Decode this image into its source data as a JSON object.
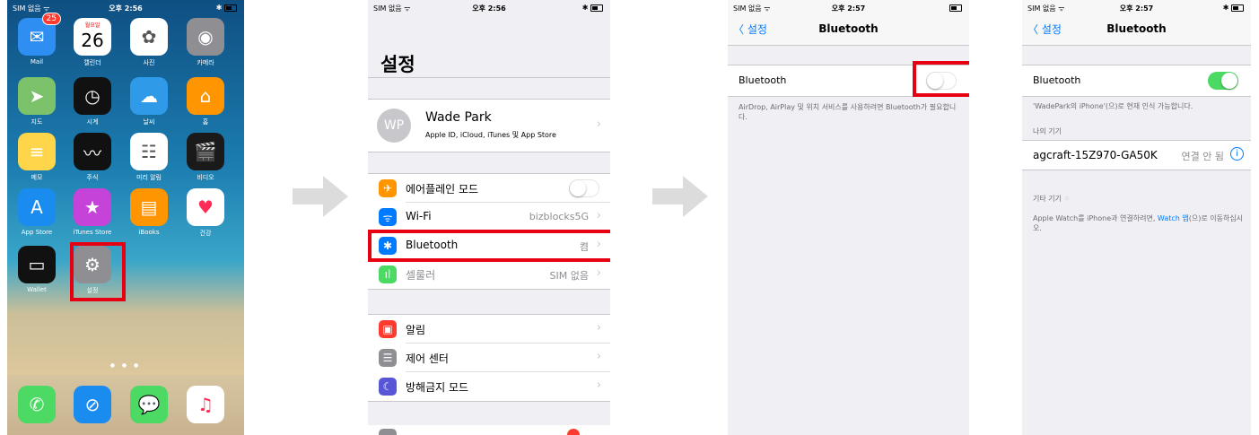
{
  "home": {
    "status": {
      "carrier": "SIM 없음 ᯤ",
      "time": "오후 2:56",
      "battery": "✱"
    },
    "apps": [
      {
        "label": "Mail",
        "icon": "mail-icon",
        "glyph": "✉",
        "color": "#2f8ef2",
        "badge": "25"
      },
      {
        "label": "캘린더",
        "icon": "calendar-icon",
        "glyph": "26",
        "color": "#ffffff",
        "sub": "월요일"
      },
      {
        "label": "사진",
        "icon": "photos-icon",
        "glyph": "✿",
        "color": "#ffffff"
      },
      {
        "label": "카메라",
        "icon": "camera-icon",
        "glyph": "◉",
        "color": "#8e8e93"
      },
      {
        "label": "지도",
        "icon": "maps-icon",
        "glyph": "➤",
        "color": "#7cc26b"
      },
      {
        "label": "시계",
        "icon": "clock-icon",
        "glyph": "◷",
        "color": "#111111"
      },
      {
        "label": "날씨",
        "icon": "weather-icon",
        "glyph": "☁",
        "color": "#2f9be8"
      },
      {
        "label": "홈",
        "icon": "home-icon",
        "glyph": "⌂",
        "color": "#ff9500"
      },
      {
        "label": "메모",
        "icon": "notes-icon",
        "glyph": "≡",
        "color": "#ffd54a"
      },
      {
        "label": "주식",
        "icon": "stocks-icon",
        "glyph": "〰",
        "color": "#111111"
      },
      {
        "label": "미리 알림",
        "icon": "reminders-icon",
        "glyph": "☷",
        "color": "#ffffff"
      },
      {
        "label": "비디오",
        "icon": "videos-icon",
        "glyph": "🎬",
        "color": "#1a1a1a"
      },
      {
        "label": "App Store",
        "icon": "app-store-icon",
        "glyph": "A",
        "color": "#1a8cf0"
      },
      {
        "label": "iTunes Store",
        "icon": "itunes-store-icon",
        "glyph": "★",
        "color": "#c543d8"
      },
      {
        "label": "iBooks",
        "icon": "ibooks-icon",
        "glyph": "▤",
        "color": "#ff9500"
      },
      {
        "label": "건강",
        "icon": "health-icon",
        "glyph": "♥",
        "color": "#ffffff"
      },
      {
        "label": "Wallet",
        "icon": "wallet-icon",
        "glyph": "▭",
        "color": "#111111"
      },
      {
        "label": "설정",
        "icon": "settings-gear-icon",
        "glyph": "⚙",
        "color": "#8e8e93"
      }
    ],
    "dock": [
      {
        "icon": "phone-icon",
        "glyph": "✆",
        "color": "#4cd964"
      },
      {
        "icon": "safari-icon",
        "glyph": "⊘",
        "color": "#1a8cf0"
      },
      {
        "icon": "messages-icon",
        "glyph": "💬",
        "color": "#4cd964"
      },
      {
        "icon": "music-icon",
        "glyph": "♫",
        "color": "#ffffff"
      }
    ]
  },
  "settings": {
    "status": {
      "carrier": "SIM 없음 ᯤ",
      "time": "오후 2:56",
      "battery": "✱"
    },
    "title": "설정",
    "profile": {
      "initials": "WP",
      "name": "Wade Park",
      "subtitle": "Apple ID, iCloud, iTunes 및 App Store"
    },
    "rows": [
      {
        "label": "에어플레인 모드",
        "value": "",
        "icon": "airplane-icon",
        "glyph": "✈",
        "color": "#ff9500",
        "toggle": "off"
      },
      {
        "label": "Wi-Fi",
        "value": "bizblocks5G",
        "icon": "wifi-icon",
        "glyph": "ᯤ",
        "color": "#007aff"
      },
      {
        "label": "Bluetooth",
        "value": "켬",
        "icon": "bluetooth-icon",
        "glyph": "✱",
        "color": "#007aff"
      },
      {
        "label": "셀룰러",
        "value": "SIM 없음",
        "icon": "cellular-icon",
        "glyph": "ıl",
        "color": "#4cd964"
      }
    ],
    "rows2": [
      {
        "label": "알림",
        "icon": "notifications-icon",
        "glyph": "▣",
        "color": "#ff3b30"
      },
      {
        "label": "제어 센터",
        "icon": "control-center-icon",
        "glyph": "☰",
        "color": "#8e8e93"
      },
      {
        "label": "방해금지 모드",
        "icon": "do-not-disturb-icon",
        "glyph": "☾",
        "color": "#5856d6"
      }
    ]
  },
  "bt_off": {
    "status": {
      "carrier": "SIM 없음 ᯤ",
      "time": "오후 2:57",
      "battery": ""
    },
    "back": "〈 설정",
    "title": "Bluetooth",
    "row_label": "Bluetooth",
    "footer": "AirDrop, AirPlay 및 위치 서비스를 사용하려면 Bluetooth가 필요합니다.",
    "toggle": "off"
  },
  "bt_on": {
    "status": {
      "carrier": "SIM 없음 ᯤ",
      "time": "오후 2:57",
      "battery": "✱"
    },
    "back": "〈 설정",
    "title": "Bluetooth",
    "row_label": "Bluetooth",
    "toggle": "on",
    "discoverable": "'WadePark의 iPhone'(으)로 현재 인식 가능합니다.",
    "my_devices_header": "나의 기기",
    "device": {
      "name": "agcraft-15Z970-GA50K",
      "status": "연결 안 됨"
    },
    "other_devices_header": "기타 기기",
    "watch_note_pre": "Apple Watch를 iPhone과 연결하려면, ",
    "watch_link": "Watch 앱",
    "watch_note_post": "(으)로 이동하십시오."
  },
  "colors": {
    "highlight": "#e60012",
    "ios_blue": "#007aff",
    "toggle_on": "#4cd964",
    "arrow": "#dcdcdc"
  }
}
